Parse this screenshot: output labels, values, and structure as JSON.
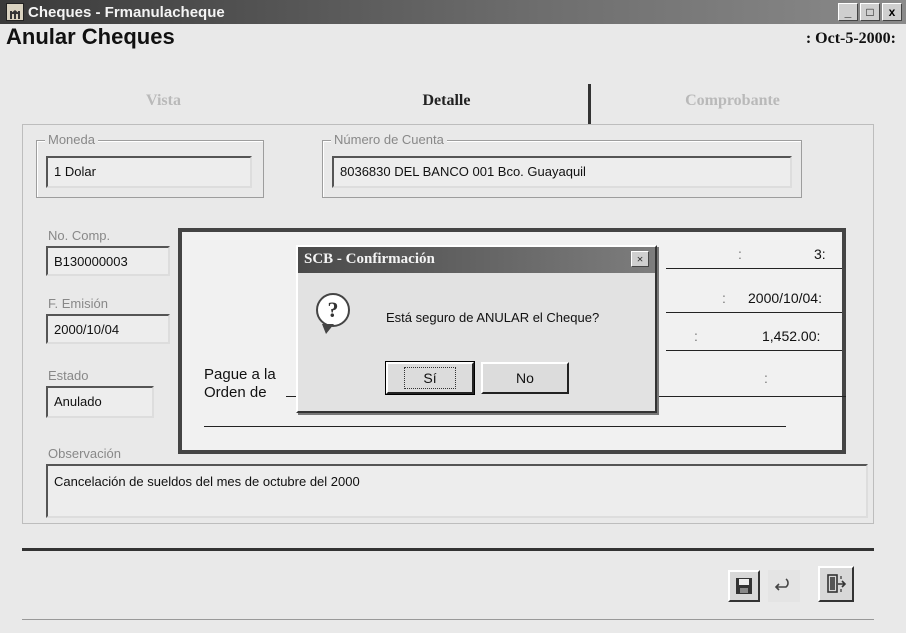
{
  "window": {
    "title": "Cheques - Frmanulacheque",
    "minimize": "_",
    "maximize": "□",
    "close": "x"
  },
  "header": {
    "page_title": "Anular Cheques",
    "date": ": Oct-5-2000:"
  },
  "tabs": [
    {
      "label": "Vista",
      "active": false
    },
    {
      "label": "Detalle",
      "active": true
    },
    {
      "label": "Comprobante",
      "active": false
    }
  ],
  "moneda": {
    "label": "Moneda",
    "value": "1 Dolar"
  },
  "cuenta": {
    "label": "Número de Cuenta",
    "value": "8036830 DEL BANCO 001 Bco. Guayaquil"
  },
  "no_comp": {
    "label": "No. Comp.",
    "value": "B130000003"
  },
  "f_emision": {
    "label": "F. Emisión",
    "value": "2000/10/04"
  },
  "estado": {
    "label": "Estado",
    "value": "Anulado"
  },
  "observacion": {
    "label": "Observación",
    "value": "Cancelación de sueldos del mes de octubre del 2000"
  },
  "cheque": {
    "number": "3:",
    "date": "2000/10/04:",
    "amount": "1,452.00:",
    "pague_a_la": "Pague a la",
    "orden_de": "Orden de",
    "colon": ":"
  },
  "dialog": {
    "title": "SCB - Confirmación",
    "close": "×",
    "message": "Está seguro de ANULAR el Cheque?",
    "yes": "Sí",
    "no": "No"
  }
}
